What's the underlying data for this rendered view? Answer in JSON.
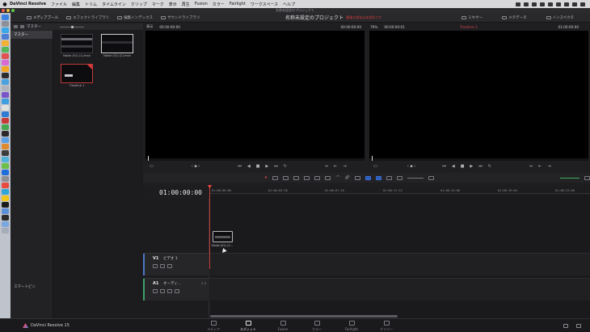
{
  "mac_menu": {
    "app": "DaVinci Resolve",
    "items": [
      "ファイル",
      "編集",
      "トリム",
      "タイムライン",
      "クリップ",
      "マーク",
      "表示",
      "再生",
      "Fusion",
      "カラー",
      "Fairlight",
      "ワークスペース",
      "ヘルプ"
    ]
  },
  "window": {
    "title": "名称未設定のプロジェクト"
  },
  "toolbar": {
    "media_pool": "メディアプール",
    "effects_library": "エフェクトライブラリ",
    "edit_index": "編集インデックス",
    "sound_library": "サウンドライブラリ",
    "project_title": "名称未設定のプロジェクト",
    "unsaved": "・ 最後の保存は未保存です",
    "mixer": "ミキサー",
    "metadata": "メタデータ",
    "inspector": "インスペクタ"
  },
  "bin_header": {
    "label": "マスター"
  },
  "bins": {
    "master": "マスター",
    "smart_bins": "スマートビン"
  },
  "clips": [
    {
      "name": "Noise (01) (1).mov"
    },
    {
      "name": "Noise (01) (2).mov"
    },
    {
      "name": "Timeline 1"
    }
  ],
  "source_viewer": {
    "label": "表示",
    "timecode_in": "00:00:00:00",
    "timecode_cur": "00:00:00:00"
  },
  "timeline_viewer": {
    "zoom": "79%",
    "timecode_dur": "00:00:00:01",
    "timeline_name": "Timeline 1",
    "timecode": "01:00:00:00"
  },
  "timeline": {
    "timecode": "01:00:00:00",
    "ruler": [
      "01:00:00:00",
      "01:00:03:20",
      "01:00:07:16",
      "01:00:11:12",
      "01:00:15:08",
      "01:00:19:04",
      "01:00:23:00"
    ],
    "tracks": [
      {
        "id": "V1",
        "name": "ビデオ 1"
      },
      {
        "id": "A1",
        "name": "オーディ...",
        "channels": "2.0"
      }
    ],
    "drag_clip": "Noise (01) (2..."
  },
  "pagebar": {
    "brand": "DaVinci Resolve 15",
    "pages": [
      "メディア",
      "エディット",
      "Fusion",
      "カラー",
      "Fairlight",
      "デリバー"
    ],
    "active": "エディット"
  },
  "colors": {
    "accent_red": "#d8383b",
    "playhead": "#e0423f",
    "audio_level": "#3fae5b",
    "brand_dock": "#bfc3cb"
  }
}
